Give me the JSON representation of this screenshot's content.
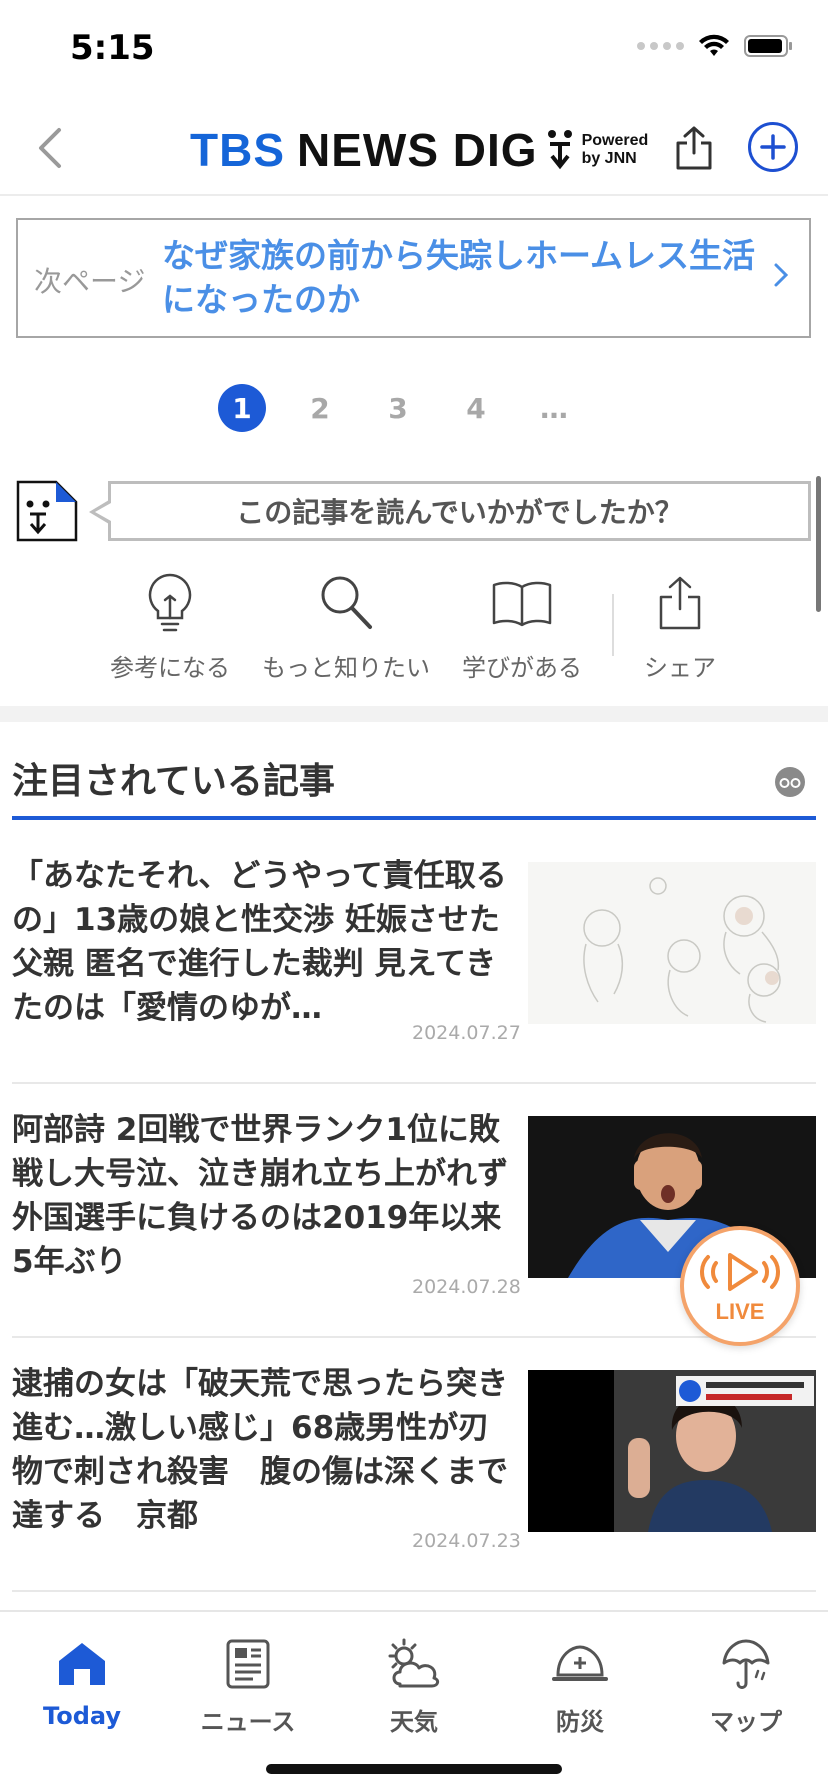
{
  "status_bar": {
    "time": "5:15"
  },
  "header": {
    "logo_tbs": "TBS",
    "logo_news": "NEWS DIG",
    "powered_line1": "Powered",
    "powered_line2": "by JNN"
  },
  "next_page": {
    "label": "次ページ",
    "title": "なぜ家族の前から失踪しホームレス生活になったのか"
  },
  "pagination": {
    "pages": [
      "1",
      "2",
      "3",
      "4",
      "…"
    ],
    "current": "1"
  },
  "feedback": {
    "prompt": "この記事を読んでいかがでしたか？",
    "reactions": [
      {
        "label": "参考になる",
        "icon": "lightbulb-icon"
      },
      {
        "label": "もっと知りたい",
        "icon": "magnifier-icon"
      },
      {
        "label": "学びがある",
        "icon": "book-icon"
      },
      {
        "label": "シェア",
        "icon": "share-icon"
      }
    ]
  },
  "trending": {
    "title": "注目されている記事",
    "articles": [
      {
        "title": "「あなたそれ、どうやって責任取るの」13歳の娘と性交渉 妊娠させた父親 匿名で進行した裁判 見えてきたのは「愛情のゆが…",
        "date": "2024.07.27"
      },
      {
        "title": "阿部詩 2回戦で世界ランク1位に敗戦し大号泣、泣き崩れ立ち上がれず 外国選手に負けるのは2019年以来5年ぶり",
        "date": "2024.07.28"
      },
      {
        "title": "逮捕の女は「破天荒で思ったら突き進む…激しい感じ」68歳男性が刃物で刺され殺害　腹の傷は深くまで達する　京都",
        "date": "2024.07.23"
      }
    ]
  },
  "live_button": {
    "label": "LIVE"
  },
  "tab_bar": {
    "items": [
      {
        "label": "Today",
        "active": true
      },
      {
        "label": "ニュース"
      },
      {
        "label": "天気"
      },
      {
        "label": "防災"
      },
      {
        "label": "マップ"
      }
    ]
  },
  "colors": {
    "brand_blue": "#1d5ad6",
    "link_blue": "#4a8fe6",
    "live_orange": "#f08a3c"
  }
}
